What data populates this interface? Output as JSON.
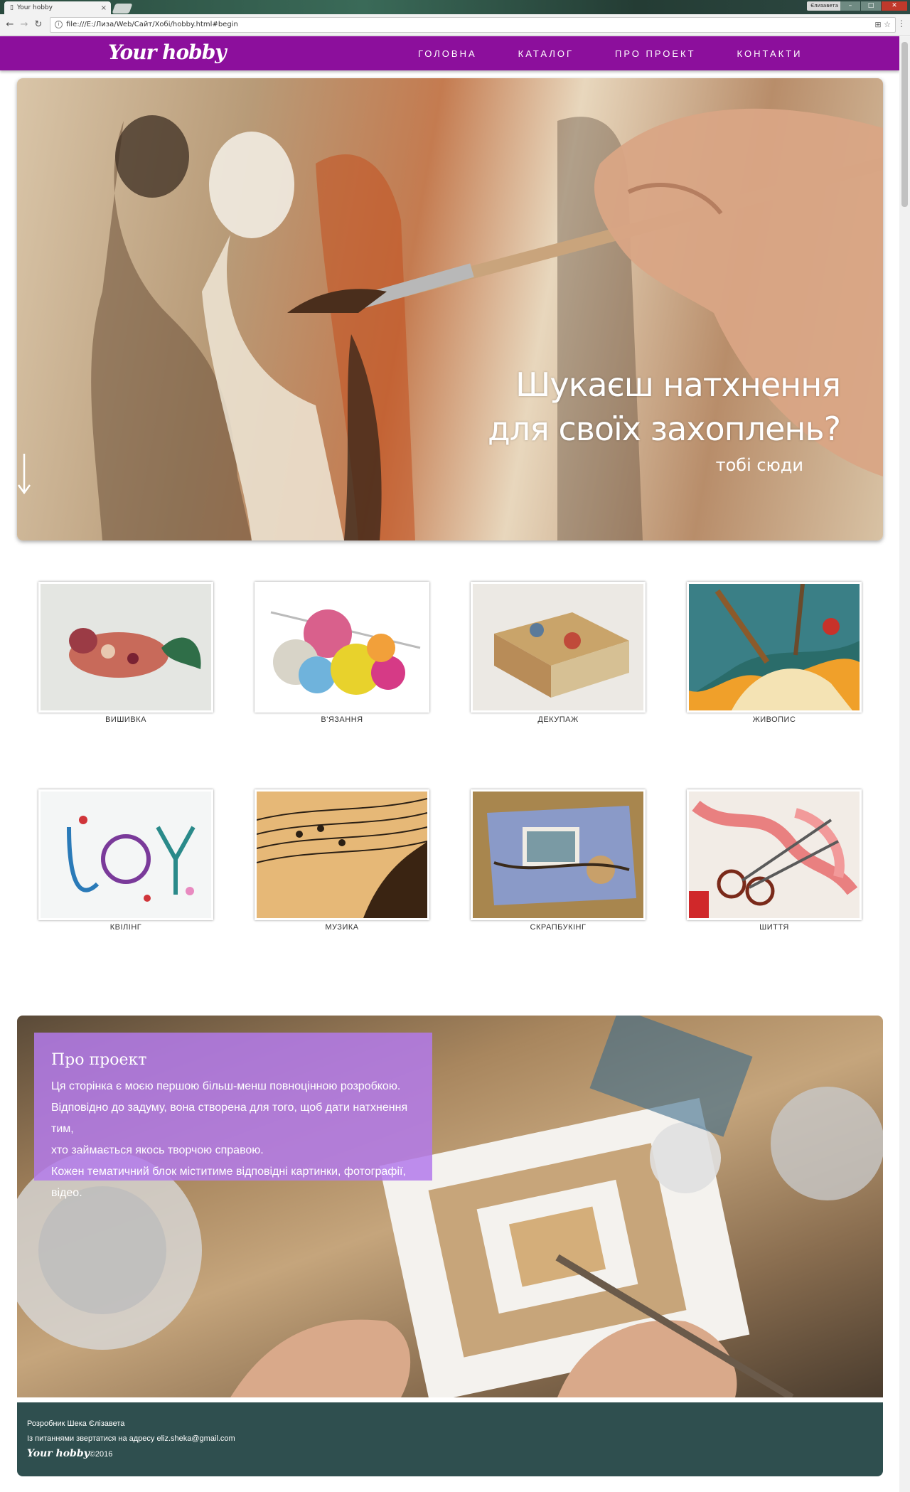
{
  "browser": {
    "tab_title": "Your hobby",
    "tab_close": "×",
    "address": "file:///E:/Лиза/Web/Сайт/Хобі/hobby.html#begin",
    "user_name": "Єлизавета",
    "back": "←",
    "forward": "→",
    "reload": "↻",
    "translate": "⊞",
    "bookmark": "☆",
    "menu": "⋮",
    "page_info": "i",
    "min": "–",
    "max": "□",
    "close": "✕"
  },
  "header": {
    "logo": "Your hobby",
    "nav": [
      "ГОЛОВНА",
      "КАТАЛОГ",
      "ПРО ПРОЕКТ",
      "КОНТАКТИ"
    ]
  },
  "hero": {
    "line1": "Шукаєш натхнення",
    "line2": "для своїх захоплень?",
    "sub": "тобі сюди"
  },
  "categories": [
    {
      "label": "ВИШИВКА",
      "icon": "embroidery-image"
    },
    {
      "label": "В'ЯЗАННЯ",
      "icon": "knitting-image"
    },
    {
      "label": "ДЕКУПАЖ",
      "icon": "decoupage-image"
    },
    {
      "label": "ЖИВОПИС",
      "icon": "painting-image"
    },
    {
      "label": "КВІЛІНГ",
      "icon": "quilling-image"
    },
    {
      "label": "МУЗИКА",
      "icon": "music-image"
    },
    {
      "label": "СКРАПБУКІНГ",
      "icon": "scrapbooking-image"
    },
    {
      "label": "ШИТТЯ",
      "icon": "sewing-image"
    }
  ],
  "about": {
    "title": "Про проект",
    "lines": [
      "Ця сторінка є моєю першою більш-менш повноцінною розробкою.",
      "Відповідно до задуму, вона створена для того, щоб дати натхнення тим,",
      "хто займається якось творчою справою.",
      "Кожен тематичний блок міститиме відповідні картинки, фотографії, відео."
    ]
  },
  "footer": {
    "developer": "Розробник Шека Єлізавета",
    "contact": "Із питаннями звертатися на адресу eliz.sheka@gmail.com",
    "logo": "Your hobby",
    "year": "©2016"
  },
  "colors": {
    "header_bg": "#8c0f9c",
    "footer_bg": "#2f4f4f",
    "about_box": "#b37aeb"
  }
}
